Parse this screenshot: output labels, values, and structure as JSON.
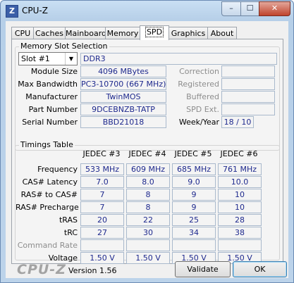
{
  "window": {
    "title": "CPU-Z",
    "icon_letter": "Z"
  },
  "titlebar_buttons": {
    "minimize": "–",
    "maximize": "☐",
    "close": "✕"
  },
  "tabs": [
    "CPU",
    "Caches",
    "Mainboard",
    "Memory",
    "SPD",
    "Graphics",
    "About"
  ],
  "active_tab": "SPD",
  "memory_slot": {
    "group_title": "Memory Slot Selection",
    "slot_selected": "Slot #1",
    "type": "DDR3",
    "labels": {
      "module_size": "Module Size",
      "max_bandwidth": "Max Bandwidth",
      "manufacturer": "Manufacturer",
      "part_number": "Part Number",
      "serial_number": "Serial Number",
      "correction": "Correction",
      "registered": "Registered",
      "buffered": "Buffered",
      "spd_ext": "SPD Ext.",
      "week_year": "Week/Year"
    },
    "values": {
      "module_size": "4096 MBytes",
      "max_bandwidth": "PC3-10700 (667 MHz)",
      "manufacturer": "TwinMOS",
      "part_number": "9DCEBNZB-TATP",
      "serial_number": "BBD21018",
      "correction": "",
      "registered": "",
      "buffered": "",
      "spd_ext": "",
      "week_year": "18 / 10"
    }
  },
  "timings": {
    "group_title": "Timings Table",
    "columns": [
      "JEDEC #3",
      "JEDEC #4",
      "JEDEC #5",
      "JEDEC #6"
    ],
    "rows": [
      {
        "label": "Frequency",
        "dim": false,
        "values": [
          "533 MHz",
          "609 MHz",
          "685 MHz",
          "761 MHz"
        ]
      },
      {
        "label": "CAS# Latency",
        "dim": false,
        "values": [
          "7.0",
          "8.0",
          "9.0",
          "10.0"
        ]
      },
      {
        "label": "RAS# to CAS#",
        "dim": false,
        "values": [
          "7",
          "8",
          "9",
          "10"
        ]
      },
      {
        "label": "RAS# Precharge",
        "dim": false,
        "values": [
          "7",
          "8",
          "9",
          "10"
        ]
      },
      {
        "label": "tRAS",
        "dim": false,
        "values": [
          "20",
          "22",
          "25",
          "28"
        ]
      },
      {
        "label": "tRC",
        "dim": false,
        "values": [
          "27",
          "30",
          "34",
          "38"
        ]
      },
      {
        "label": "Command Rate",
        "dim": true,
        "values": [
          "",
          "",
          "",
          ""
        ]
      },
      {
        "label": "Voltage",
        "dim": false,
        "values": [
          "1.50 V",
          "1.50 V",
          "1.50 V",
          "1.50 V"
        ]
      }
    ]
  },
  "footer": {
    "brand": "CPU-Z",
    "version": "Version 1.56",
    "validate_label": "Validate",
    "ok_label": "OK"
  }
}
